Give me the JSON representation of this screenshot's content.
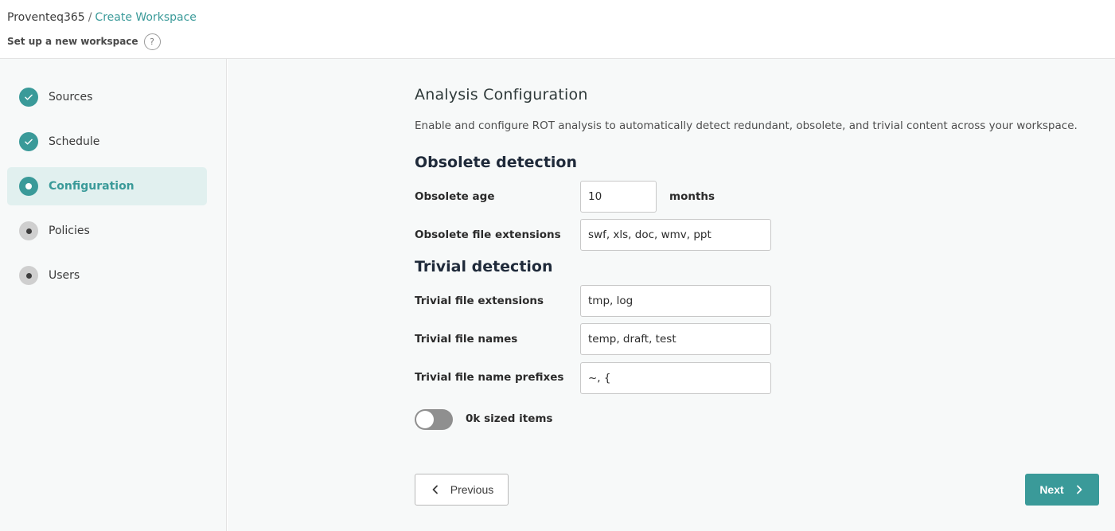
{
  "header": {
    "breadcrumb_root": "Proventeq365",
    "breadcrumb_sep": "/",
    "breadcrumb_current": "Create Workspace",
    "subtitle": "Set up a new workspace",
    "help_glyph": "?"
  },
  "sidebar": {
    "steps": [
      {
        "label": "Sources",
        "status": "completed"
      },
      {
        "label": "Schedule",
        "status": "completed"
      },
      {
        "label": "Configuration",
        "status": "current"
      },
      {
        "label": "Policies",
        "status": "pending"
      },
      {
        "label": "Users",
        "status": "pending"
      }
    ]
  },
  "main": {
    "title": "Analysis Configuration",
    "description": "Enable and configure ROT analysis to automatically detect redundant, obsolete, and trivial content across your workspace.",
    "obsolete": {
      "heading": "Obsolete detection",
      "age_label": "Obsolete age",
      "age_value": "10",
      "age_unit": "months",
      "extensions_label": "Obsolete file extensions",
      "extensions_value": "swf, xls, doc, wmv, ppt"
    },
    "trivial": {
      "heading": "Trivial detection",
      "extensions_label": "Trivial file extensions",
      "extensions_value": "tmp, log",
      "names_label": "Trivial file names",
      "names_value": "temp, draft, test",
      "prefixes_label": "Trivial file name prefixes",
      "prefixes_value": "~, {"
    },
    "zero_k_toggle": {
      "label": "0k sized items",
      "enabled": false
    },
    "buttons": {
      "previous": "Previous",
      "next": "Next"
    }
  },
  "colors": {
    "accent": "#3a9a99",
    "active_bg": "#e1f0ef",
    "panel_bg": "#f7f9f9",
    "toggle_off": "#8f8f8f"
  },
  "icons": {
    "step_completed": "check-icon",
    "step_current": "dot-icon",
    "step_pending": "dot-icon",
    "previous": "chevron-left-icon",
    "next": "chevron-right-icon",
    "help": "question-icon"
  }
}
